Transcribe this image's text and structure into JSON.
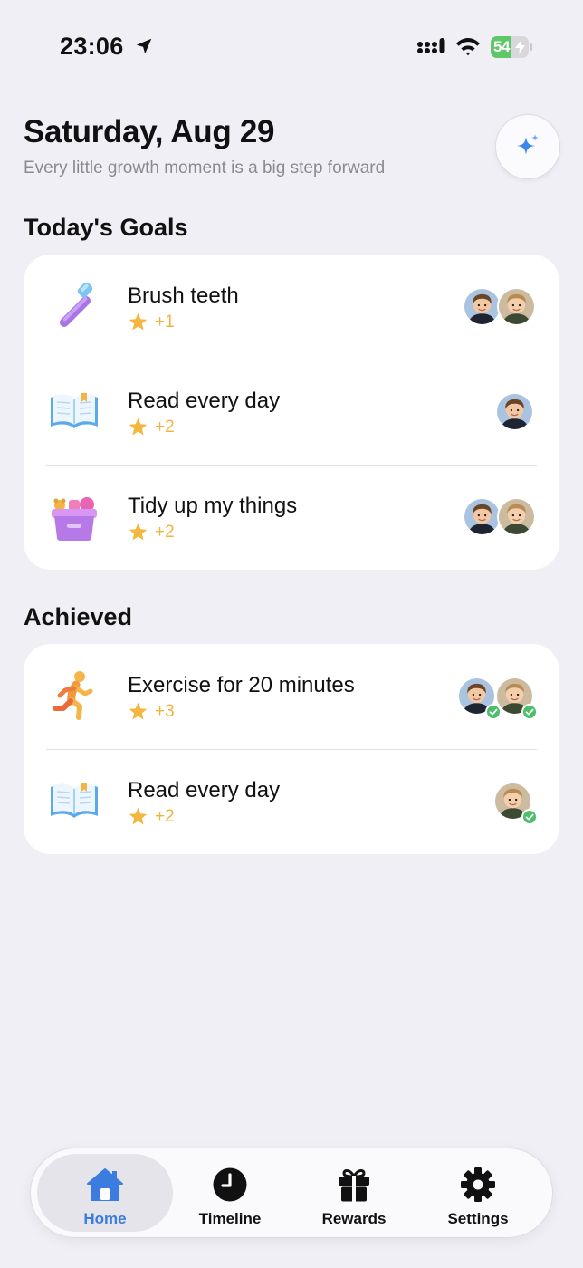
{
  "status_bar": {
    "time": "23:06",
    "battery": "54",
    "battery_level": 0.54,
    "icons": [
      "location-arrow-icon",
      "signal-icon",
      "wifi-icon",
      "battery-charging-icon"
    ]
  },
  "header": {
    "title": "Saturday, Aug 29",
    "subtitle": "Every little growth moment is a big step forward",
    "action_icon": "sparkle-icon"
  },
  "today": {
    "section_title": "Today's Goals",
    "items": [
      {
        "title": "Brush teeth",
        "points": "+1",
        "icon": "toothbrush-icon",
        "kids": [
          "kid-a",
          "kid-b"
        ]
      },
      {
        "title": "Read every day",
        "points": "+2",
        "icon": "open-book-icon",
        "kids": [
          "kid-a"
        ]
      },
      {
        "title": "Tidy up my things",
        "points": "+2",
        "icon": "toy-box-icon",
        "kids": [
          "kid-a",
          "kid-b"
        ]
      }
    ]
  },
  "achieved": {
    "section_title": "Achieved",
    "items": [
      {
        "title": "Exercise for 20 minutes",
        "points": "+3",
        "icon": "runner-icon",
        "kids": [
          "kid-a",
          "kid-b"
        ],
        "completed": true
      },
      {
        "title": "Read every day",
        "points": "+2",
        "icon": "open-book-icon",
        "kids": [
          "kid-b"
        ],
        "completed": true
      }
    ]
  },
  "tab_bar": {
    "tabs": [
      {
        "label": "Home",
        "icon": "home-icon",
        "active": true
      },
      {
        "label": "Timeline",
        "icon": "clock-icon",
        "active": false
      },
      {
        "label": "Rewards",
        "icon": "gift-icon",
        "active": false
      },
      {
        "label": "Settings",
        "icon": "gear-icon",
        "active": false
      }
    ]
  },
  "colors": {
    "background": "#f0eff5",
    "accent": "#3a7ce0",
    "star": "#f0b43c",
    "check": "#4cbf6b"
  }
}
